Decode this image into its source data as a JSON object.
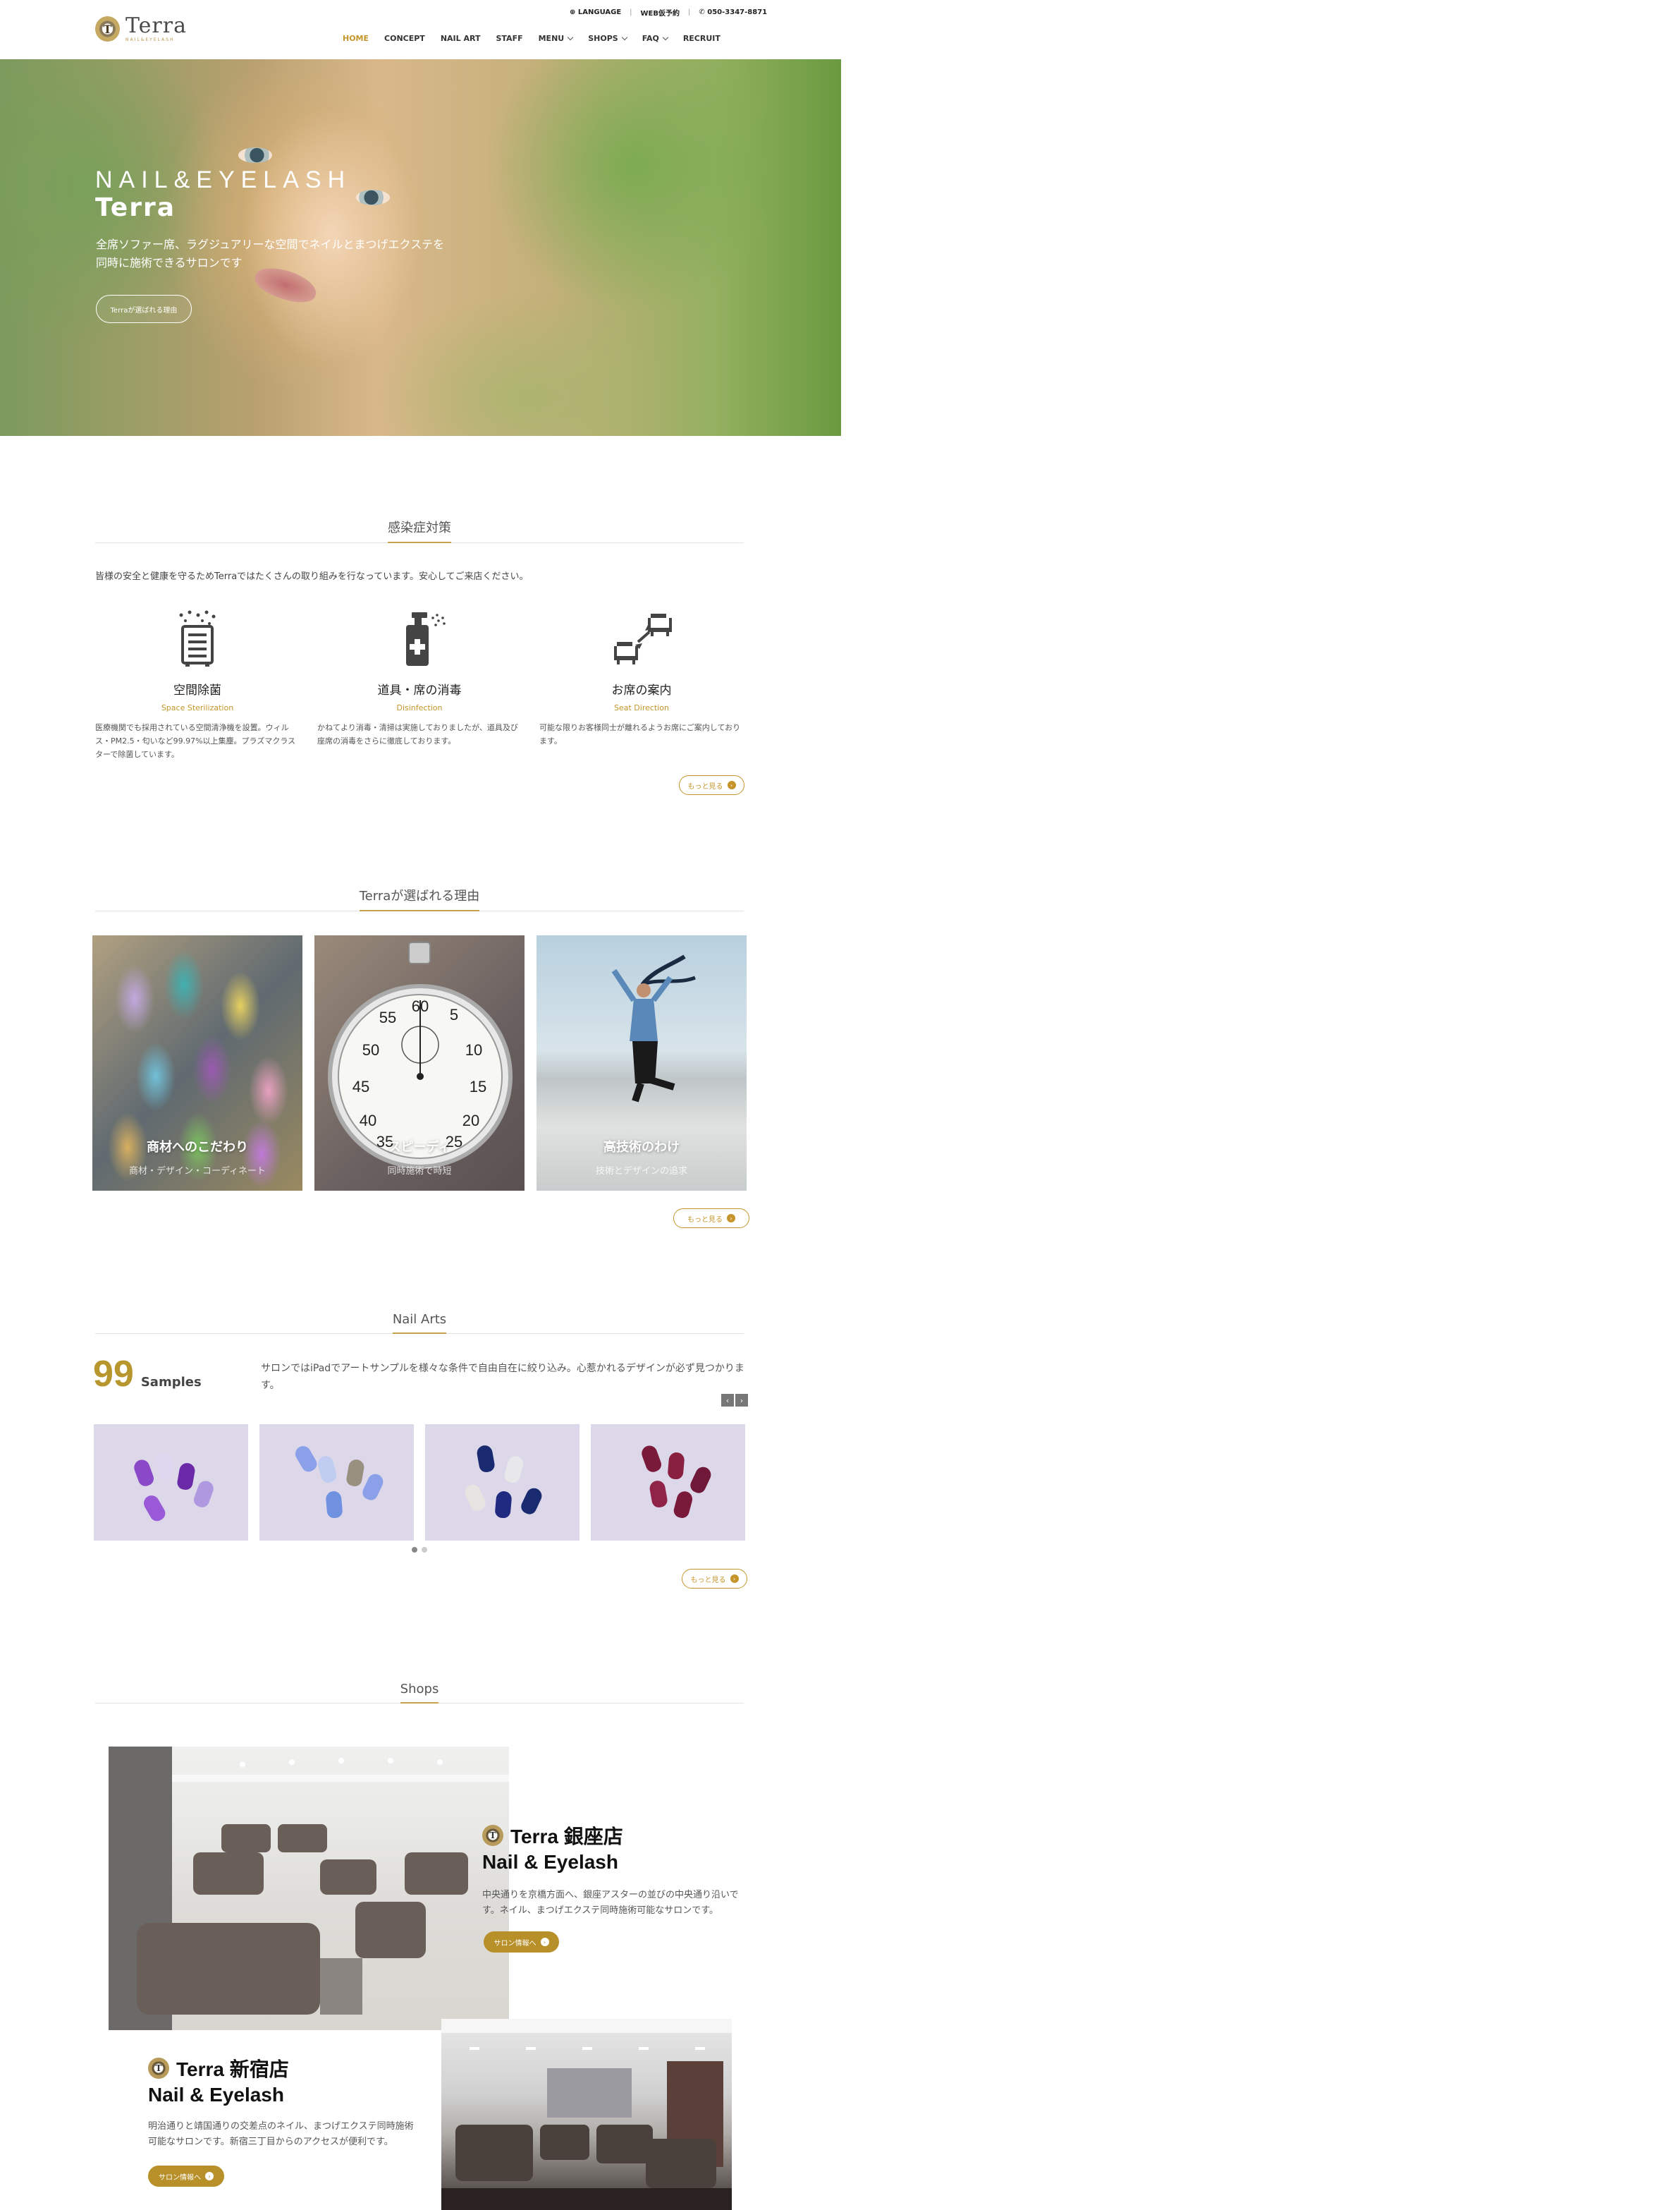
{
  "header": {
    "logo": {
      "word": "Terra",
      "sub": "NAIL&EYELASH"
    },
    "util": {
      "language": "LANGUAGE",
      "booking": "WEB仮予約",
      "phone": "050-3347-8871"
    },
    "nav": [
      {
        "label": "HOME",
        "active": true
      },
      {
        "label": "CONCEPT"
      },
      {
        "label": "NAIL ART"
      },
      {
        "label": "STAFF"
      },
      {
        "label": "MENU",
        "dropdown": true
      },
      {
        "label": "SHOPS",
        "dropdown": true
      },
      {
        "label": "FAQ",
        "dropdown": true
      },
      {
        "label": "RECRUIT"
      }
    ]
  },
  "hero": {
    "title1": "NAIL&EYELASH",
    "title2": "Terra",
    "desc": "全席ソファー席、ラグジュアリーな空間でネイルとまつげエクステを同時に施術できるサロンです",
    "button": "Terraが選ばれる理由"
  },
  "infection": {
    "heading": "感染症対策",
    "lead": "皆様の安全と健康を守るためTerraではたくさんの取り組みを行なっています。安心してご来店ください。",
    "items": [
      {
        "title": "空間除菌",
        "en": "Space Sterilization",
        "desc": "医療機関でも採用されている空間清浄機を設置。ウィルス・PM2.5・匂いなど99.97%以上集塵。プラズマクラスターで除菌しています。",
        "icon": "air-purifier-icon"
      },
      {
        "title": "道具・席の消毒",
        "en": "Disinfection",
        "desc": "かねてより消毒・清掃は実施しておりましたが、道具及び座席の消毒をさらに徹底しております。",
        "icon": "spray-bottle-icon"
      },
      {
        "title": "お席の案内",
        "en": "Seat Direction",
        "desc": "可能な限りお客様同士が離れるようお席にご案内しております。",
        "icon": "seat-distance-icon"
      }
    ],
    "more": "もっと見る"
  },
  "reasons": {
    "heading": "Terraが選ばれる理由",
    "items": [
      {
        "title": "商材へのこだわり",
        "sub": "商材・デザイン・コーディネート"
      },
      {
        "title": "スピーディ",
        "sub": "同時施術で時短"
      },
      {
        "title": "高技術のわけ",
        "sub": "技術とデザインの追求"
      }
    ],
    "more": "もっと見る"
  },
  "nailarts": {
    "heading": "Nail Arts",
    "count": "99",
    "count_label": "Samples",
    "desc": "サロンではiPadでアートサンプルを様々な条件で自由自在に絞り込み。心惹かれるデザインが必ず見つかります。",
    "prev": "‹",
    "next": "›",
    "more": "もっと見る"
  },
  "shops": {
    "heading": "Shops",
    "items": [
      {
        "title": "Terra 銀座店",
        "sub": "Nail & Eyelash",
        "desc": "中央通りを京橋方面へ、銀座アスターの並びの中央通り沿いです。ネイル、まつげエクステ同時施術可能なサロンです。",
        "button": "サロン情報へ"
      },
      {
        "title": "Terra 新宿店",
        "sub": "Nail & Eyelash",
        "desc": "明治通りと靖国通りの交差点のネイル、まつげエクステ同時施術可能なサロンです。新宿三丁目からのアクセスが便利です。",
        "button": "サロン情報へ"
      }
    ]
  },
  "colors": {
    "accent": "#c5952b",
    "button_gold": "#b8902a"
  }
}
